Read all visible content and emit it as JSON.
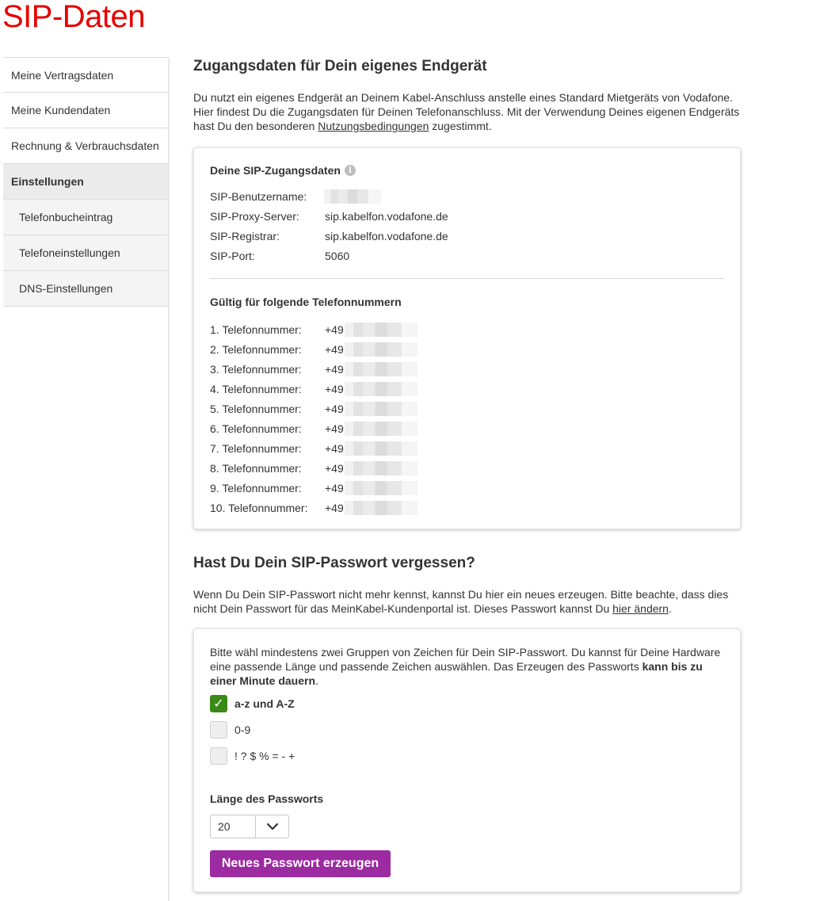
{
  "page": {
    "title": "SIP-Daten"
  },
  "sidebar": {
    "items": [
      {
        "label": "Meine Vertragsdaten"
      },
      {
        "label": "Meine Kundendaten"
      },
      {
        "label": "Rechnung & Verbrauchsdaten"
      },
      {
        "label": "Einstellungen"
      },
      {
        "label": "Telefonbucheintrag"
      },
      {
        "label": "Telefoneinstellungen"
      },
      {
        "label": "DNS-Einstellungen"
      }
    ]
  },
  "access": {
    "heading": "Zugangsdaten für Dein eigenes Endgerät",
    "intro_before": "Du nutzt ein eigenes Endgerät an Deinem Kabel-Anschluss anstelle eines Standard Mietgeräts von Vodafone. Hier findest Du die Zugangsdaten für Deinen Telefonanschluss. Mit der Verwendung Deines eigenen Endgeräts hast Du den besonderen ",
    "intro_link": "Nutzungsbedingungen",
    "intro_after": " zugestimmt.",
    "card": {
      "title": "Deine SIP-Zugangsdaten",
      "info_icon": "i",
      "rows": [
        {
          "label": "SIP-Benutzername:",
          "value": ""
        },
        {
          "label": "SIP-Proxy-Server:",
          "value": "sip.kabelfon.vodafone.de"
        },
        {
          "label": "SIP-Registrar:",
          "value": "sip.kabelfon.vodafone.de"
        },
        {
          "label": "SIP-Port:",
          "value": "5060"
        }
      ],
      "numbers_title": "Gültig für folgende Telefonnummern",
      "numbers": [
        {
          "label": "1. Telefonnummer:",
          "prefix": "+49"
        },
        {
          "label": "2. Telefonnummer:",
          "prefix": "+49"
        },
        {
          "label": "3. Telefonnummer:",
          "prefix": "+49"
        },
        {
          "label": "4. Telefonnummer:",
          "prefix": "+49"
        },
        {
          "label": "5. Telefonnummer:",
          "prefix": "+49"
        },
        {
          "label": "6. Telefonnummer:",
          "prefix": "+49"
        },
        {
          "label": "7. Telefonnummer:",
          "prefix": "+49"
        },
        {
          "label": "8. Telefonnummer:",
          "prefix": "+49"
        },
        {
          "label": "9. Telefonnummer:",
          "prefix": "+49"
        },
        {
          "label": "10. Telefonnummer:",
          "prefix": "+49"
        }
      ]
    }
  },
  "password": {
    "heading": "Hast Du Dein SIP-Passwort vergessen?",
    "intro_before": "Wenn Du Dein SIP-Passwort nicht mehr kennst, kannst Du hier ein neues erzeugen. Bitte beachte, dass dies nicht Dein Passwort für das MeinKabel-Kundenportal ist. Dieses Passwort kannst Du ",
    "intro_link": "hier ändern",
    "intro_after": ".",
    "card": {
      "desc_before": "Bitte wähl mindestens zwei Gruppen von Zeichen für Dein SIP-Passwort. Du kannst für Deine Hardware eine passende Länge und passende Zeichen auswählen. Das Erzeugen des Passworts ",
      "desc_bold": "kann bis zu einer Minute dauern",
      "desc_after": ".",
      "options": [
        {
          "label": "a-z und A-Z",
          "checked": true
        },
        {
          "label": "0-9",
          "checked": false
        },
        {
          "label": "! ? $ % = - +",
          "checked": false
        }
      ],
      "length_label": "Länge des Passworts",
      "length_value": "20",
      "button_label": "Neues Passwort erzeugen"
    }
  },
  "colors": {
    "brand_red": "#e60000",
    "button_purple": "#9c2aa0",
    "check_green": "#3b8a16"
  }
}
